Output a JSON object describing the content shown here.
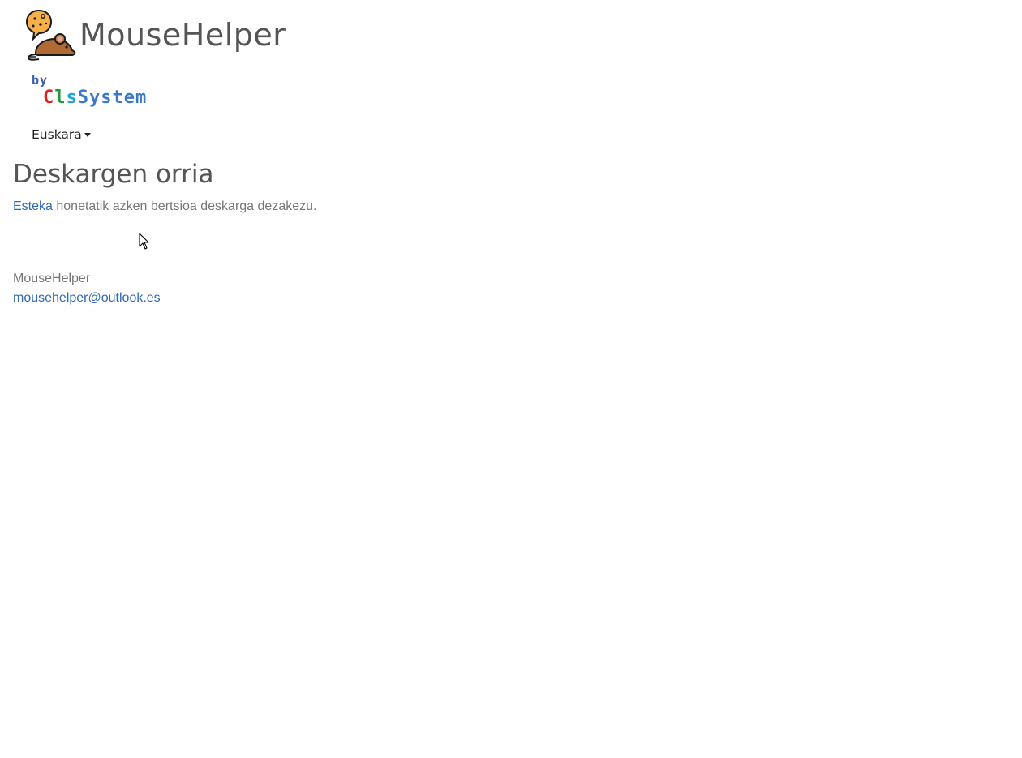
{
  "header": {
    "brand_name": "MouseHelper",
    "byline_prefix": "by",
    "byline_company": {
      "part1": "C",
      "part2": "l",
      "part3": "s",
      "part4": "System"
    }
  },
  "language_selector": {
    "selected": "Euskara"
  },
  "main": {
    "title": "Deskargen orria",
    "intro_link": "Esteka",
    "intro_text": " honetatik azken bertsioa deskarga dezakezu."
  },
  "footer": {
    "name": "MouseHelper",
    "email": "mousehelper@outlook.es"
  },
  "colors": {
    "link": "#2f6ab3",
    "title": "#555555",
    "body_text": "#777777",
    "byline_red": "#e02020",
    "byline_green": "#1f9a3a",
    "byline_cyan": "#1fa6d6",
    "byline_blue": "#3b78c8"
  },
  "icons": {
    "logo": "mouse-with-speech-bubble-icon",
    "language_dropdown": "caret-down-icon",
    "pointer": "mouse-cursor-icon"
  }
}
